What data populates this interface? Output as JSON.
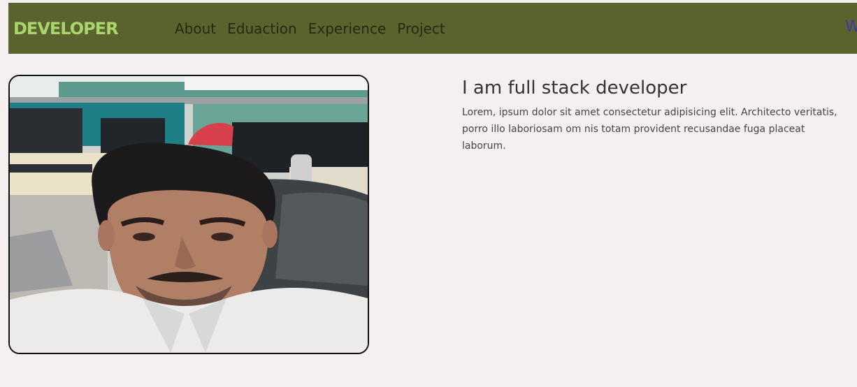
{
  "brand": {
    "logo_text": "DEVELOPER",
    "logo_color": "#a8d66c",
    "navbar_color": "#5a632e"
  },
  "nav": {
    "items": [
      {
        "label": "About"
      },
      {
        "label": "Eduaction"
      },
      {
        "label": "Experience"
      },
      {
        "label": "Project"
      }
    ],
    "right_label": "W"
  },
  "hero": {
    "photo_name": "profile-photo",
    "heading": "I am full stack developer",
    "paragraph": "Lorem, ipsum dolor sit amet consectetur adipisicing elit. Architecto veritatis, porro illo laboriosam om nis totam provident recusandae fuga placeat laborum."
  }
}
